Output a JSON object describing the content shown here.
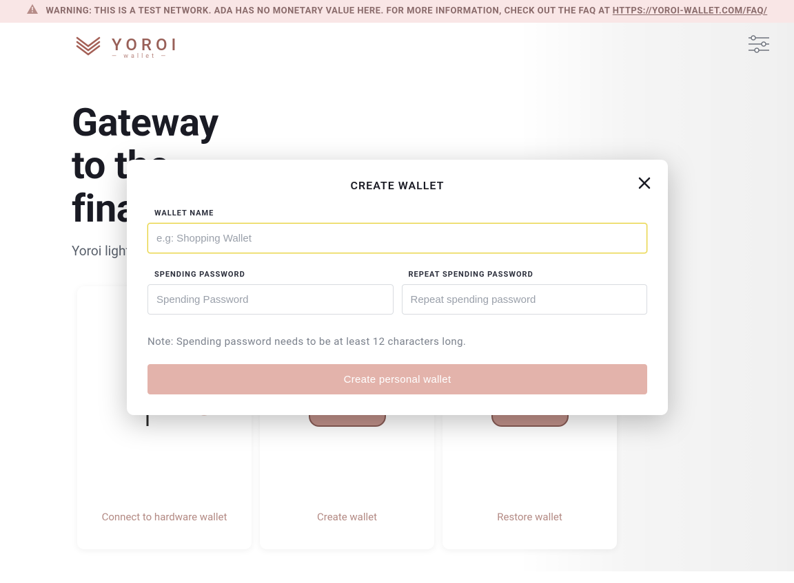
{
  "banner": {
    "text_prefix": "WARNING: THIS IS A TEST NETWORK. ADA HAS NO MONETARY VALUE HERE. FOR MORE INFORMATION, CHECK OUT THE FAQ AT ",
    "link_text": "HTTPS://YOROI-WALLET.COM/FAQ/"
  },
  "brand": {
    "name": "YOROI",
    "subtitle": "wallet"
  },
  "hero": {
    "line1": "Gateway",
    "line2": "to the",
    "line3": "financial world",
    "subtitle": "Yoroi light wallet for Cardano assets"
  },
  "cards": [
    {
      "label": "Connect to hardware wallet"
    },
    {
      "label": "Create wallet"
    },
    {
      "label": "Restore wallet"
    }
  ],
  "modal": {
    "title": "CREATE WALLET",
    "wallet_name_label": "WALLET NAME",
    "wallet_name_placeholder": "e.g: Shopping Wallet",
    "wallet_name_value": "",
    "spending_label": "SPENDING PASSWORD",
    "spending_placeholder": "Spending Password",
    "spending_value": "",
    "repeat_label": "REPEAT SPENDING PASSWORD",
    "repeat_placeholder": "Repeat spending password",
    "repeat_value": "",
    "note": "Note: Spending password needs to be at least 12 characters long.",
    "submit_label": "Create personal wallet"
  },
  "icons": {
    "warning": "warning-triangle",
    "settings": "sliders"
  },
  "colors": {
    "accent": "#e3b3ab",
    "banner_bg": "#fae6e6",
    "focus": "#e7d23a"
  }
}
